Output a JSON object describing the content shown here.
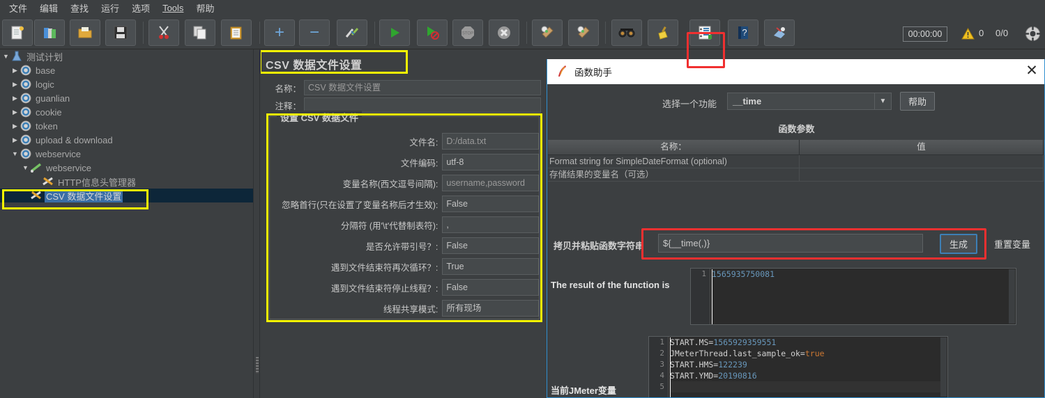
{
  "menu": {
    "items": [
      {
        "label": "文件"
      },
      {
        "label": "编辑"
      },
      {
        "label": "查找"
      },
      {
        "label": "运行"
      },
      {
        "label": "选项"
      },
      {
        "label": "Tools"
      },
      {
        "label": "帮助"
      }
    ]
  },
  "toolbar": {
    "buttons": [
      {
        "name": "new",
        "glyph": "🗎"
      },
      {
        "name": "templates",
        "glyph": "📚"
      },
      {
        "name": "open",
        "glyph": "📂"
      },
      {
        "name": "save",
        "glyph": "💾"
      },
      {
        "name": "cut",
        "glyph": "✂"
      },
      {
        "name": "copy",
        "glyph": "🗐"
      },
      {
        "name": "paste",
        "glyph": "📋"
      },
      {
        "name": "expand-all",
        "glyph": "+"
      },
      {
        "name": "collapse-all",
        "glyph": "−"
      },
      {
        "name": "toggle",
        "glyph": "✂"
      },
      {
        "name": "start",
        "glyph": "▶"
      },
      {
        "name": "start-no-pauses",
        "glyph": "▶"
      },
      {
        "name": "stop",
        "glyph": "⏹"
      },
      {
        "name": "shutdown",
        "glyph": "✖"
      },
      {
        "name": "clear",
        "glyph": "🧹"
      },
      {
        "name": "clear-all",
        "glyph": "🧹"
      },
      {
        "name": "search",
        "glyph": "🔍"
      },
      {
        "name": "reset-search",
        "glyph": "🧹"
      },
      {
        "name": "function-helper",
        "glyph": "📝"
      },
      {
        "name": "help",
        "glyph": "?"
      },
      {
        "name": "undo-redo",
        "glyph": "✨"
      }
    ],
    "timer": "00:00:00",
    "warning_count": "0",
    "thread_count": "0/0"
  },
  "tree": {
    "nodes": [
      {
        "label": "测试计划",
        "twisty": "▼",
        "icon": "flask-icon",
        "indent": 0,
        "selected": false
      },
      {
        "label": "base",
        "twisty": "▶",
        "icon": "gear-icon",
        "indent": 1,
        "selected": false
      },
      {
        "label": "logic",
        "twisty": "▶",
        "icon": "gear-icon",
        "indent": 1,
        "selected": false
      },
      {
        "label": "guanlian",
        "twisty": "▶",
        "icon": "gear-icon",
        "indent": 1,
        "selected": false
      },
      {
        "label": "cookie",
        "twisty": "▶",
        "icon": "gear-icon",
        "indent": 1,
        "selected": false
      },
      {
        "label": "token",
        "twisty": "▶",
        "icon": "gear-icon",
        "indent": 1,
        "selected": false
      },
      {
        "label": "upload & download",
        "twisty": "▶",
        "icon": "gear-icon",
        "indent": 1,
        "selected": false
      },
      {
        "label": "webservice",
        "twisty": "▼",
        "icon": "gear-icon",
        "indent": 1,
        "selected": false
      },
      {
        "label": "webservice",
        "twisty": "▼",
        "icon": "pen-icon",
        "indent": 2,
        "selected": false
      },
      {
        "label": "HTTP信息头管理器",
        "twisty": "",
        "icon": "tools-icon",
        "indent": 3,
        "selected": false
      },
      {
        "label": "CSV 数据文件设置",
        "twisty": "",
        "icon": "tools-icon",
        "indent": 2,
        "selected": true
      }
    ]
  },
  "csv_panel": {
    "title": "CSV 数据文件设置",
    "name_label": "名称：",
    "name_value": "CSV 数据文件设置",
    "comment_label": "注释：",
    "comment_value": "",
    "group_title": "设置 CSV 数据文件",
    "fields": [
      {
        "label": "文件名:",
        "value": "D:/data.txt",
        "muted": true
      },
      {
        "label": "文件编码:",
        "value": "utf-8",
        "muted": false
      },
      {
        "label": "变量名称(西文逗号间隔):",
        "value": "username,password",
        "muted": true
      },
      {
        "label": "忽略首行(只在设置了变量名称后才生效):",
        "value": "False",
        "muted": false
      },
      {
        "label": "分隔符 (用'\\t'代替制表符):",
        "value": ",",
        "muted": false
      },
      {
        "label": "是否允许带引号？:",
        "value": "False",
        "muted": false
      },
      {
        "label": "遇到文件结束符再次循环？:",
        "value": "True",
        "muted": false
      },
      {
        "label": "遇到文件结束符停止线程？:",
        "value": "False",
        "muted": false
      },
      {
        "label": "线程共享模式:",
        "value": "所有现场",
        "muted": false
      }
    ]
  },
  "dialog": {
    "title": "函数助手",
    "close_label": "✕",
    "select_function_label": "选择一个功能",
    "selected_function": "__time",
    "help_button": "帮助",
    "params_title": "函数参数",
    "params_headers": [
      "名称：",
      "值"
    ],
    "params_rows": [
      {
        "name": "Format string for SimpleDateFormat (optional)",
        "value": ""
      },
      {
        "name": "存储结果的变量名（可选）",
        "value": ""
      }
    ],
    "paste_label": "拷贝并粘贴函数字符串",
    "paste_value": "${__time(,)}",
    "generate_button": "生成",
    "reset_button": "重置变量",
    "result_label": "The result of the function is",
    "result_lines": [
      {
        "num": "1",
        "text": "1565935750081",
        "type": "number"
      }
    ],
    "vars_label": "当前JMeter变量",
    "vars_lines": [
      {
        "num": "1",
        "key": "START.MS=",
        "val": "1565929359551",
        "type": "number"
      },
      {
        "num": "2",
        "key": "JMeterThread.last_sample_ok=",
        "val": "true",
        "type": "bool"
      },
      {
        "num": "3",
        "key": "START.HMS=",
        "val": "122239",
        "type": "number"
      },
      {
        "num": "4",
        "key": "START.YMD=",
        "val": "20190816",
        "type": "number"
      },
      {
        "num": "5",
        "key": "",
        "val": "",
        "type": "none"
      }
    ]
  },
  "colors": {
    "background": "#3c3f41",
    "accent_blue": "#3a6ea5",
    "highlight_yellow": "#f5f500",
    "highlight_red": "#f03030",
    "code_background": "#2b2b2b",
    "number_token": "#6897bb",
    "bool_token": "#cc7832"
  }
}
